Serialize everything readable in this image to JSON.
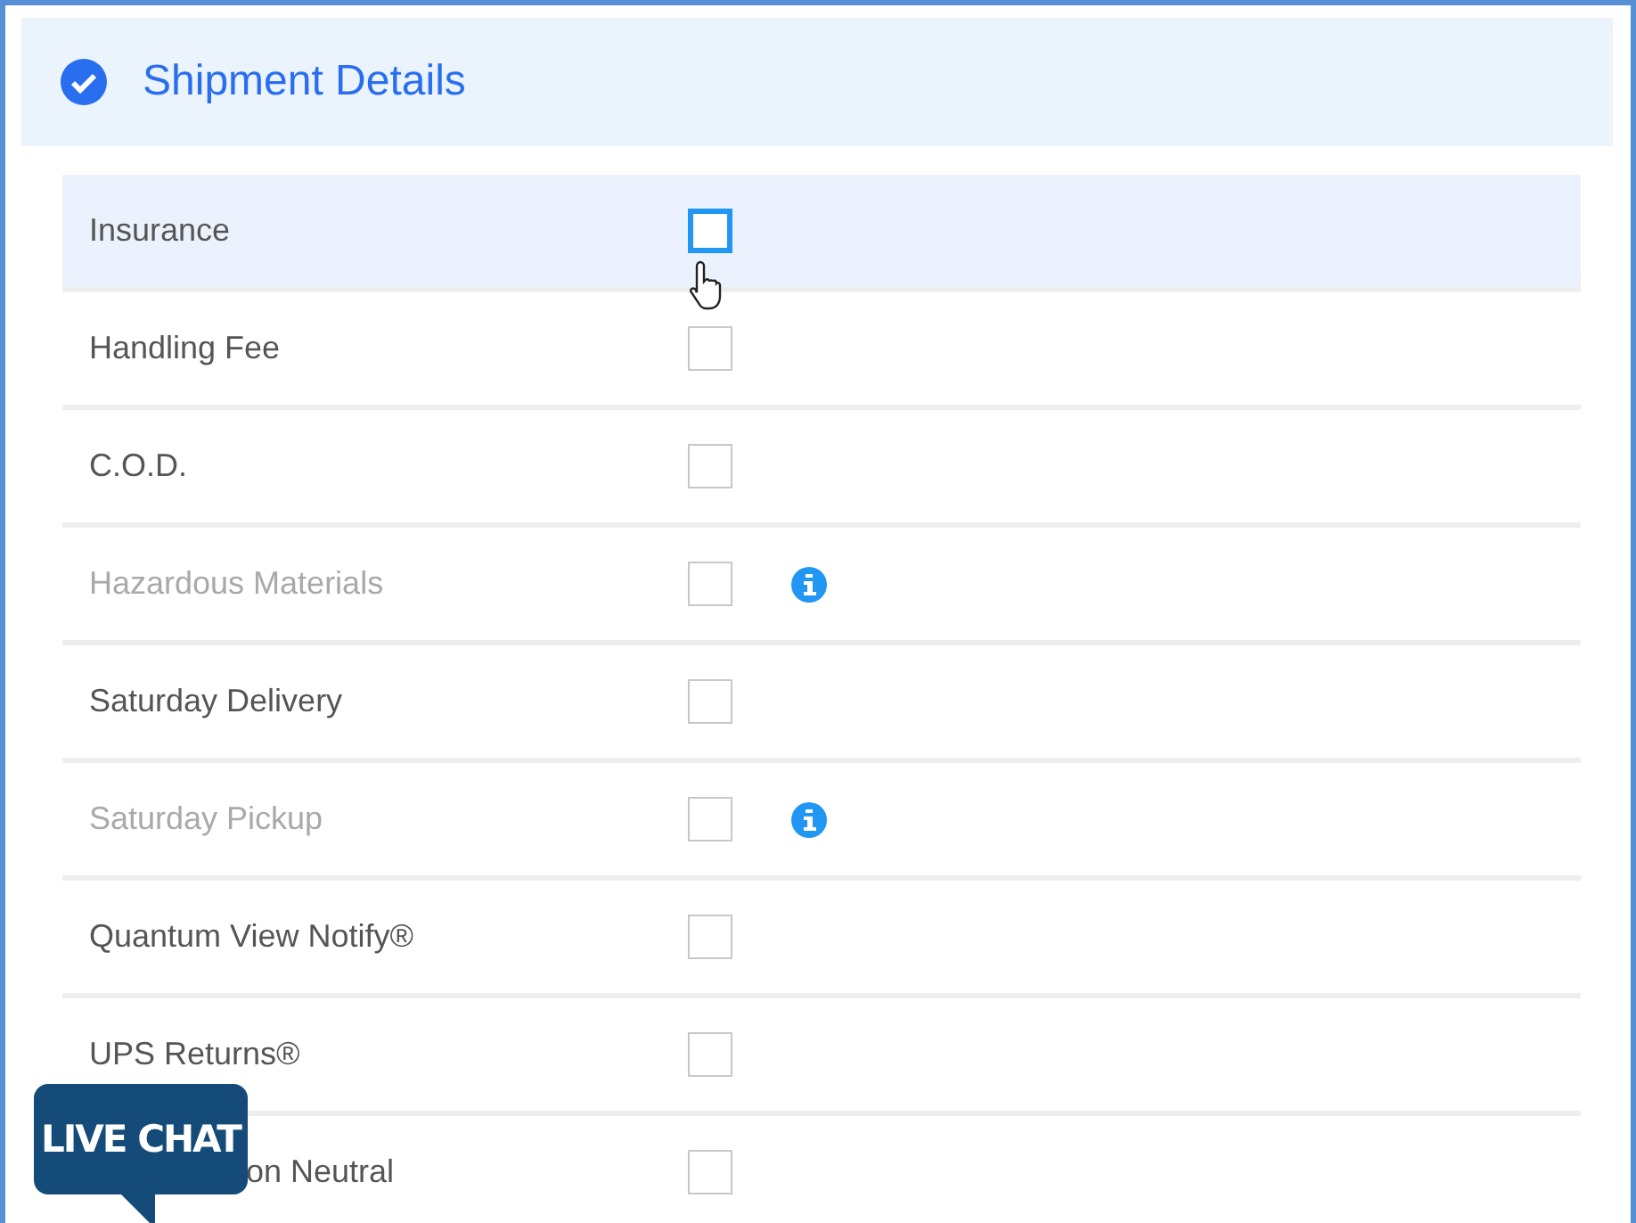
{
  "section": {
    "title": "Shipment Details",
    "completed": true
  },
  "options": [
    {
      "label": "Insurance",
      "checked": false,
      "hovered": true,
      "disabled": false,
      "info": false
    },
    {
      "label": "Handling Fee",
      "checked": false,
      "hovered": false,
      "disabled": false,
      "info": false
    },
    {
      "label": "C.O.D.",
      "checked": false,
      "hovered": false,
      "disabled": false,
      "info": false
    },
    {
      "label": "Hazardous Materials",
      "checked": false,
      "hovered": false,
      "disabled": true,
      "info": true
    },
    {
      "label": "Saturday Delivery",
      "checked": false,
      "hovered": false,
      "disabled": false,
      "info": false
    },
    {
      "label": "Saturday Pickup",
      "checked": false,
      "hovered": false,
      "disabled": true,
      "info": true
    },
    {
      "label": "Quantum View Notify®",
      "checked": false,
      "hovered": false,
      "disabled": false,
      "info": false
    },
    {
      "label": "UPS Returns®",
      "checked": false,
      "hovered": false,
      "disabled": false,
      "info": false
    },
    {
      "label": "on Neutral",
      "checked": false,
      "hovered": false,
      "disabled": false,
      "info": false,
      "partly_hidden": true
    }
  ],
  "live_chat": {
    "label": "LIVE CHAT"
  }
}
